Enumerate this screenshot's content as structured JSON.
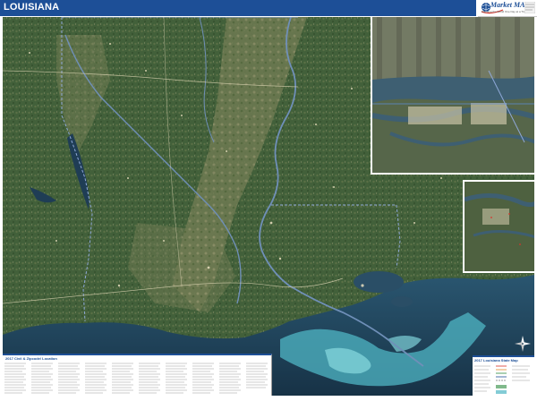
{
  "title": "LOUISIANA",
  "brand": {
    "name": "Market MAPS",
    "tagline": "Mapping the World One Day at a Time"
  },
  "index_panel": {
    "title": "2017 Civil & Zipcode/ Location"
  },
  "legend_panel": {
    "title": "2017 Louisiana State Map"
  },
  "colors": {
    "title_bar": "#1d4f97",
    "land": "#3f5a34",
    "water": "#1f3d55",
    "shallow_water": "#4fb6c4",
    "boundary": "#8fa8d8"
  },
  "icons": {
    "compass": "north-arrow-icon",
    "logo": "globe-logo-icon"
  }
}
